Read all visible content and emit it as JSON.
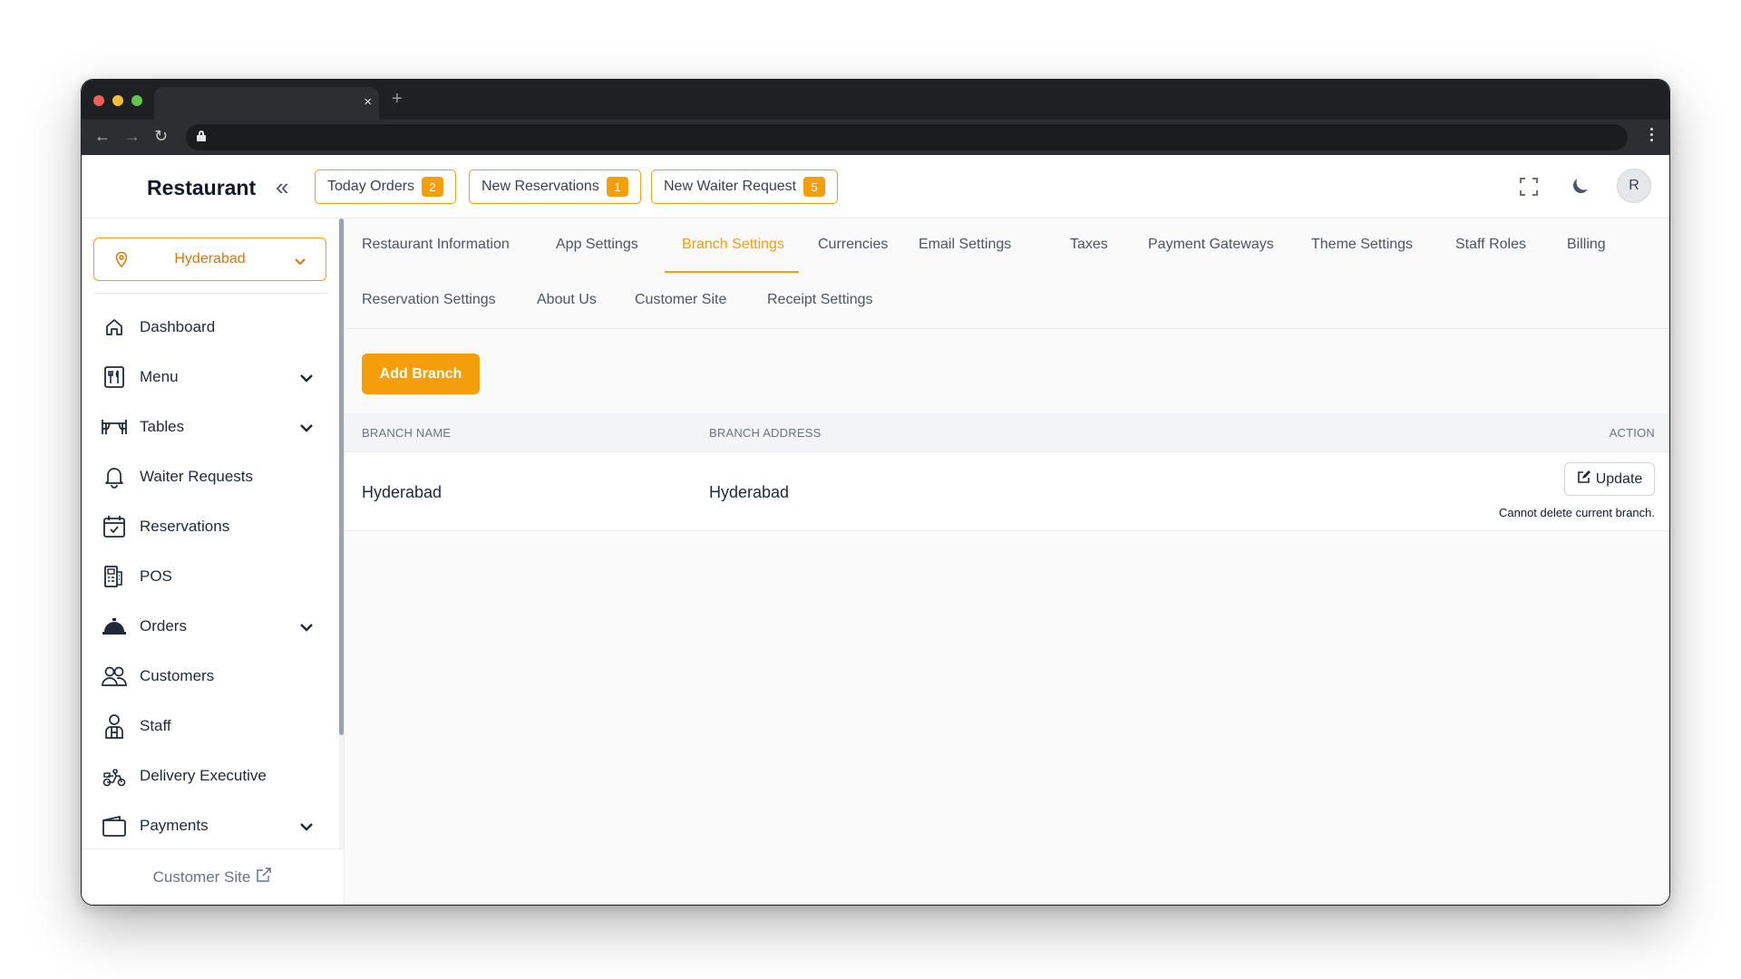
{
  "browser": {
    "tab_close": "×",
    "new_tab": "+"
  },
  "header": {
    "brand": "Restaurant",
    "pills": [
      {
        "label": "Today Orders",
        "count": "2"
      },
      {
        "label": "New Reservations",
        "count": "1"
      },
      {
        "label": "New Waiter Request",
        "count": "5"
      }
    ],
    "avatar_initial": "R"
  },
  "sidebar": {
    "branch": "Hyderabad",
    "items": [
      {
        "label": "Dashboard",
        "icon": "home-icon",
        "expandable": false
      },
      {
        "label": "Menu",
        "icon": "menu-icon",
        "expandable": true
      },
      {
        "label": "Tables",
        "icon": "tables-icon",
        "expandable": true
      },
      {
        "label": "Waiter Requests",
        "icon": "bell-icon",
        "expandable": false
      },
      {
        "label": "Reservations",
        "icon": "calendar-check-icon",
        "expandable": false
      },
      {
        "label": "POS",
        "icon": "pos-icon",
        "expandable": false
      },
      {
        "label": "Orders",
        "icon": "cloche-icon",
        "expandable": true
      },
      {
        "label": "Customers",
        "icon": "users-icon",
        "expandable": false
      },
      {
        "label": "Staff",
        "icon": "staff-icon",
        "expandable": false
      },
      {
        "label": "Delivery Executive",
        "icon": "scooter-icon",
        "expandable": false
      },
      {
        "label": "Payments",
        "icon": "wallet-icon",
        "expandable": true
      }
    ],
    "footer_link": "Customer Site"
  },
  "settings_tabs": {
    "row1": [
      "Restaurant Information",
      "App Settings",
      "Branch Settings",
      "Currencies",
      "Email Settings",
      "Taxes",
      "Payment Gateways",
      "Theme Settings",
      "Staff Roles",
      "Billing"
    ],
    "row2": [
      "Reservation Settings",
      "About Us",
      "Customer Site",
      "Receipt Settings"
    ],
    "active": "Branch Settings"
  },
  "branches": {
    "add_button": "Add Branch",
    "columns": [
      "BRANCH NAME",
      "BRANCH ADDRESS",
      "ACTION"
    ],
    "rows": [
      {
        "name": "Hyderabad",
        "address": "Hyderabad",
        "update_label": "Update",
        "note": "Cannot delete current branch."
      }
    ]
  },
  "colors": {
    "accent": "#f59e0b",
    "chrome": "#1f2023"
  }
}
